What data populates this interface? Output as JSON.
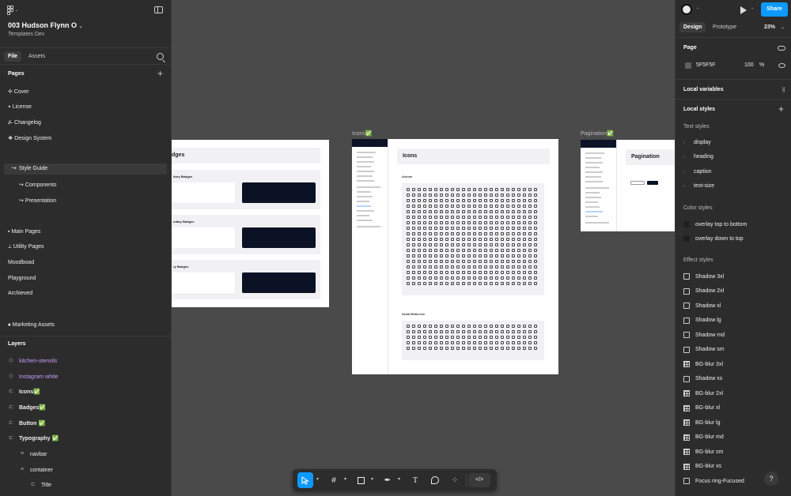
{
  "file": {
    "title": "003 Hudson Flynn O",
    "subtitle": "Templates Dev",
    "tab_file": "File",
    "tab_assets": "Assets"
  },
  "pages": {
    "heading": "Pages",
    "items": [
      "✢ Cover",
      "⭑ License",
      "⍼ Changelog",
      "❖ Design System",
      "Style Guide",
      "Components",
      "Presentation",
      "▪ Main Pages",
      "⟂ Utility Pages",
      "Moodboad",
      "Playground",
      "Archieved",
      "♠ Marketing Assets"
    ]
  },
  "layers": {
    "heading": "Layers",
    "items": [
      "kitchen-utensils",
      "Instagram white",
      "Icons✅",
      "Badges✅",
      "Button ✅",
      "Typography ✅",
      "navbar",
      "container",
      "Title"
    ]
  },
  "canvas": {
    "frame_icons_label": "Icons✅",
    "frame_pagination_label": "Pagination✅",
    "badges_heading": "dges",
    "icons_heading": "Icons",
    "pagination_heading": "Pagination",
    "icons_section1": "Unicorn",
    "icons_section2": "Social Media Icon",
    "badge_row_titles": [
      "itory Badges",
      "ndary Badges",
      "ry Badges"
    ]
  },
  "right": {
    "share": "Share",
    "tab_design": "Design",
    "tab_prototype": "Prototype",
    "zoom": "23%",
    "page_heading": "Page",
    "page_color": "5F5F5F",
    "page_opacity": "100",
    "page_pct": "%",
    "local_variables": "Local variables",
    "local_styles": "Local styles",
    "text_styles_heading": "Text styles",
    "text_styles": [
      "display",
      "heading",
      "caption",
      "text-size"
    ],
    "color_styles_heading": "Color styles",
    "color_styles": [
      "overlay top to bottom",
      "overlay down to top"
    ],
    "effect_styles_heading": "Effect styles",
    "effect_styles": [
      "Shadow 3xl",
      "Shadow 2xl",
      "Shadow xl",
      "Shadow lg",
      "Shadow md",
      "Shadow sm",
      "BG-blur 3xl",
      "Shadow xs",
      "BG-blur 2xl",
      "BG-blur xl",
      "BG-blur lg",
      "BG-blur md",
      "BG-blur sm",
      "BG-blur xs",
      "Focus ring-Fucused"
    ],
    "help": "?"
  },
  "colors": {
    "accent": "#0d99ff",
    "panel": "#2c2c2c",
    "canvas": "#4a4a4a",
    "component": "#c79cff"
  }
}
